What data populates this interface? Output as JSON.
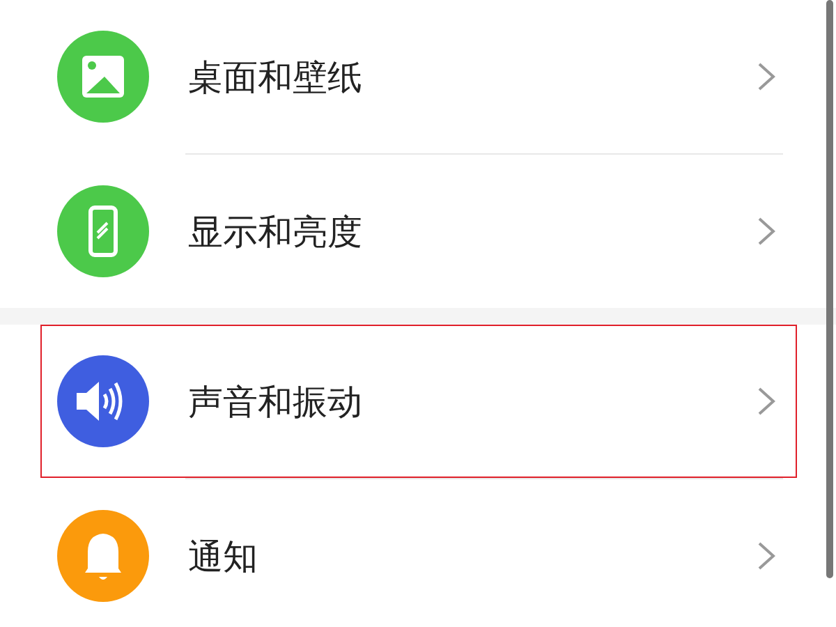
{
  "groups": [
    {
      "items": [
        {
          "label": "桌面和壁纸",
          "kind": "picture",
          "color": "#4cc94a",
          "highlighted": false
        },
        {
          "label": "显示和亮度",
          "kind": "phone",
          "color": "#4cc94a",
          "highlighted": false
        }
      ]
    },
    {
      "items": [
        {
          "label": "声音和振动",
          "kind": "speaker",
          "color": "#3f5ee0",
          "highlighted": true
        },
        {
          "label": "通知",
          "kind": "bell",
          "color": "#fb9a0c",
          "highlighted": false
        }
      ]
    }
  ]
}
